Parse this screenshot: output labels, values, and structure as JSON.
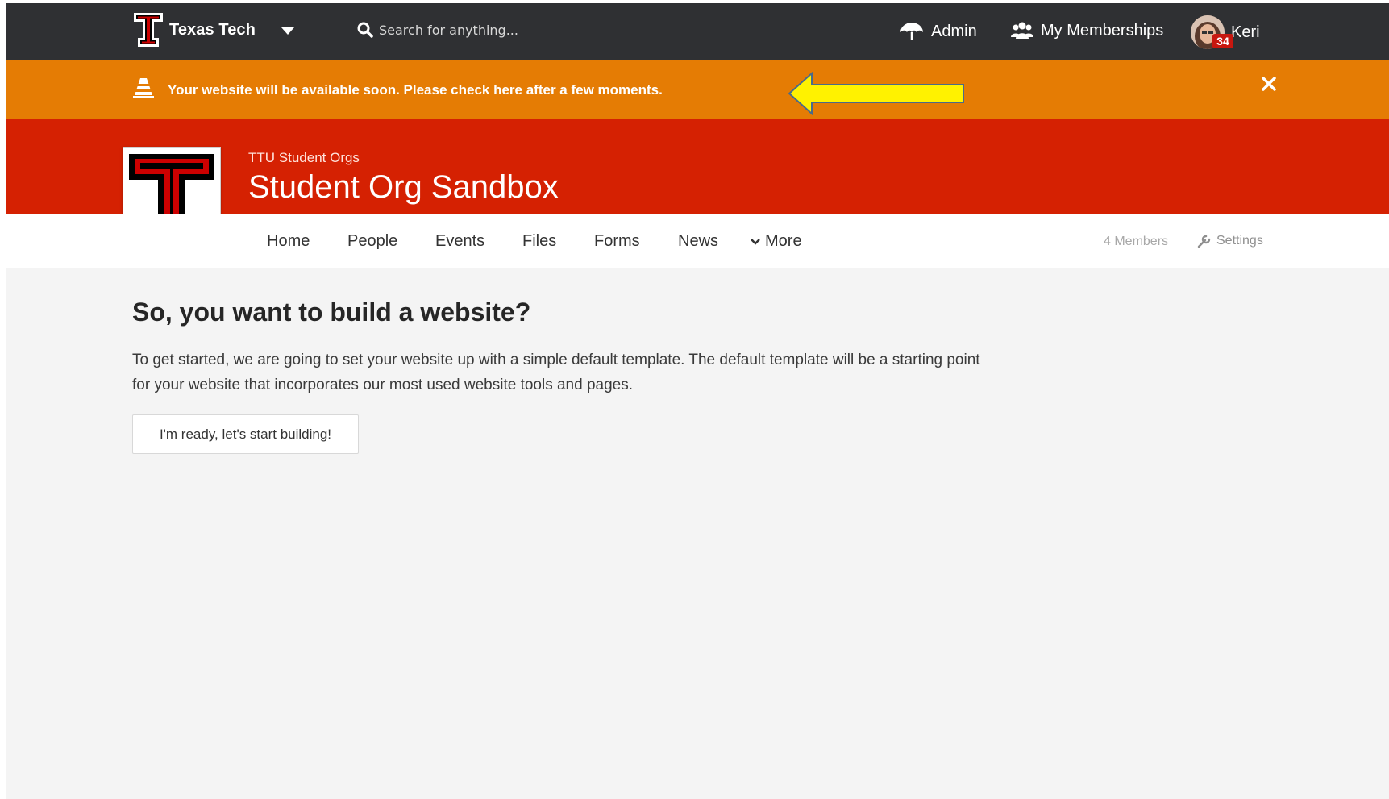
{
  "topnav": {
    "brand": "Texas Tech",
    "search_placeholder": "Search for anything...",
    "admin_label": "Admin",
    "memberships_label": "My Memberships",
    "user_name": "Keri",
    "notification_count": "34"
  },
  "alert": {
    "message": "Your website will be available soon. Please check here after a few moments.",
    "icon": "traffic-cone-icon",
    "color": "#e57c04"
  },
  "org": {
    "parent": "TTU Student Orgs",
    "title": "Student Org Sandbox",
    "header_color": "#d52102"
  },
  "subnav": {
    "items": [
      "Home",
      "People",
      "Events",
      "Files",
      "Forms",
      "News"
    ],
    "more_label": "More",
    "members_count": "4 Members",
    "settings_label": "Settings"
  },
  "main": {
    "heading": "So, you want to build a website?",
    "paragraph": "To get started, we are going to set your website up with a simple default template. The default template will be a starting point for your website that incorporates our most used website tools and pages.",
    "button_label": "I'm ready, let's start building!"
  }
}
